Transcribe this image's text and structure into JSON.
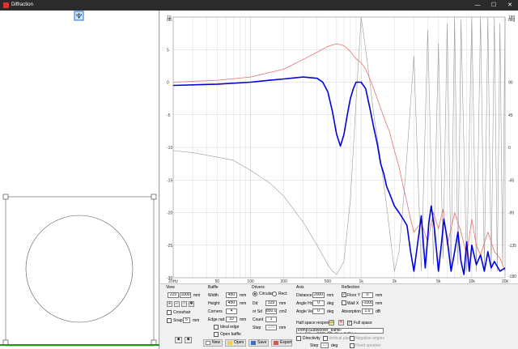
{
  "window": {
    "title": "Diffraction",
    "minimize": "—",
    "maximize": "☐",
    "close": "✕"
  },
  "view": {
    "title": "View",
    "width": "225",
    "height": "1000",
    "unit": "mm",
    "crosshair": "Crosshair",
    "snap": "Snap",
    "snap_value": "5",
    "snap_unit": "mm"
  },
  "baffle": {
    "title": "Baffle",
    "width_label": "Width",
    "width": "450",
    "height_label": "Height",
    "height": "450",
    "corners_label": "Corners",
    "corners": "4",
    "edge_label": "Edge rad.",
    "edge": "10",
    "unit": "mm",
    "ideal_edge": "Ideal edge",
    "open_baffle": "Open baffle"
  },
  "drivers": {
    "title": "Drivers",
    "circular": "Circular",
    "rect": "Rect.",
    "dd_label": "Dd",
    "dd": "329",
    "dd_unit": "mm",
    "sd_label": "or Sd",
    "sd": "850.0",
    "sd_unit": "cm2",
    "count_label": "Count",
    "count": "1",
    "step_label": "Step",
    "step": "120",
    "step_unit": "mm"
  },
  "axis": {
    "title": "Axis",
    "distance_label": "Distance",
    "distance": "2000",
    "distance_unit": "mm",
    "hor_label": "Angle Hor",
    "hor": "0",
    "hor_unit": "deg",
    "ver_label": "Angle Ver",
    "ver": "0",
    "ver_unit": "deg"
  },
  "reflection": {
    "title": "Reflection",
    "floor_label": "Floor Y",
    "floor": "0",
    "floor_unit": "mm",
    "wall_label": "Wall X",
    "wall": "-1000",
    "wall_unit": "mm",
    "absorption_label": "Absorption",
    "absorption": "1.0",
    "absorption_unit": "dB"
  },
  "halfspace": {
    "label": "Half space response",
    "full_space": "Full space",
    "path": "e\\tmp\\Subwoofer_baffle-step\\VituixCAD_FR_Flat_0dB.txt",
    "directivity": "Directivity",
    "vertical_plane": "Vertical plane",
    "negative_angles": "Negative angles",
    "step_label": "Step",
    "step": "10",
    "step_unit": "deg",
    "fixed_speaker": "Fixed speaker"
  },
  "buttons": {
    "new": "New",
    "open": "Open",
    "save": "Save",
    "export": "Export"
  },
  "chart_data": {
    "type": "line",
    "x_scale": "log",
    "xlim": [
      20,
      20000
    ],
    "x_ticks": [
      "20Hz",
      "50",
      "100",
      "200",
      "500",
      "1k",
      "2k",
      "5k",
      "10k",
      "20k"
    ],
    "y_left_ticks": [
      "10",
      "dB",
      "5",
      "0",
      "-5",
      "-10",
      "-15",
      "-20",
      "-25",
      "-30"
    ],
    "y_left_lim": [
      -30,
      10
    ],
    "y_right_ticks": [
      "180",
      "deg",
      "90",
      "45",
      "0",
      "-45",
      "-90",
      "-135",
      "-180"
    ],
    "y_right_lim": [
      -180,
      180
    ],
    "grid": true,
    "colors": {
      "response": "#0000dd",
      "diffraction": "#e87070",
      "phase": "#9a9a9a",
      "grid": "#d4d4d4"
    },
    "series": [
      {
        "x": [
          20,
          50,
          100,
          150,
          200,
          300,
          400,
          450,
          500,
          550,
          600,
          650,
          700,
          750,
          800,
          850,
          900,
          1000,
          1100,
          1200,
          1300,
          1400,
          1500,
          1600,
          1700,
          1800,
          2000,
          2200,
          2400,
          2600,
          2800,
          3000,
          3200,
          3500,
          3800,
          4100,
          4300,
          4600,
          5000,
          5300,
          5600,
          6000,
          6500,
          7000,
          7500,
          8000,
          8500,
          9000,
          9500,
          10000,
          11000,
          12000,
          13000,
          14000,
          15000,
          16000,
          18000,
          20000
        ],
        "y": [
          -0.5,
          -0.3,
          0.0,
          0.3,
          0.5,
          0.8,
          0.6,
          0.0,
          -1.5,
          -4.5,
          -8.0,
          -9.8,
          -8.0,
          -5.0,
          -2.5,
          -1.0,
          0.0,
          0.0,
          -1.0,
          -4.0,
          -7.0,
          -9.5,
          -12.5,
          -14.0,
          -16.0,
          -17.0,
          -19.0,
          -20.0,
          -21.0,
          -22.0,
          -26.0,
          -29.0,
          -25.5,
          -20.5,
          -28.5,
          -21.5,
          -19.0,
          -22.5,
          -29.0,
          -25.0,
          -21.0,
          -24.0,
          -29.0,
          -26.0,
          -23.0,
          -27.5,
          -29.5,
          -24.5,
          -29.0,
          -25.0,
          -28.0,
          -26.5,
          -29.0,
          -26.0,
          -28.5,
          -27.5,
          -29.0,
          -28.5
        ]
      },
      {
        "x": [
          20,
          50,
          100,
          200,
          300,
          400,
          500,
          600,
          700,
          800,
          900,
          1000,
          1100,
          1200,
          1300,
          1500,
          1700,
          1800,
          2000,
          2200,
          2400,
          2600,
          2800,
          3000,
          3500,
          4000,
          4500,
          5000,
          5500,
          6000,
          6500,
          7000,
          8000,
          9000,
          10000,
          11000,
          12000,
          14000,
          16000,
          18000,
          20000
        ],
        "y": [
          0.0,
          0.3,
          0.8,
          2.0,
          3.5,
          4.6,
          5.5,
          5.9,
          5.6,
          4.7,
          3.6,
          3.0,
          2.0,
          0.5,
          -1.0,
          -4.0,
          -6.5,
          -7.5,
          -10.5,
          -13.0,
          -16.0,
          -18.5,
          -21.0,
          -23.0,
          -21.5,
          -24.5,
          -20.0,
          -22.5,
          -19.5,
          -25.0,
          -22.5,
          -20.0,
          -23.0,
          -26.5,
          -21.0,
          -25.0,
          -26.5,
          -23.0,
          -26.0,
          -27.0,
          -29.0
        ]
      },
      {
        "x": [
          20,
          30,
          50,
          70,
          100,
          150,
          200,
          300,
          400,
          500,
          550,
          600,
          700,
          800,
          900,
          1000,
          1100,
          1200,
          1300,
          1500,
          1700,
          2000,
          2200,
          2500,
          3000,
          3500,
          4000,
          4500,
          5000,
          5500,
          6000,
          6500,
          7000,
          7500,
          8000,
          9000,
          10000,
          11000,
          12000,
          13000,
          14000,
          15000,
          16000,
          17000,
          18000,
          19000,
          20000
        ],
        "y": [
          -10.5,
          -10.8,
          -11.5,
          -12.0,
          -13.5,
          -15.5,
          -17.5,
          -21.5,
          -25.0,
          -28.0,
          -29.0,
          -29.5,
          -27.5,
          -18.0,
          -3.0,
          10.0,
          5.0,
          0.0,
          -5.0,
          -12.0,
          -19.0,
          -29.0,
          -26.0,
          -15.0,
          4.0,
          -29.0,
          8.0,
          -28.0,
          6.0,
          -27.0,
          9.0,
          -29.0,
          10.0,
          -28.0,
          9.5,
          -29.0,
          10.0,
          -29.0,
          10.0,
          -28.5,
          10.0,
          -29.0,
          10.0,
          -29.0,
          9.0,
          -28.0,
          10.0
        ]
      }
    ]
  }
}
